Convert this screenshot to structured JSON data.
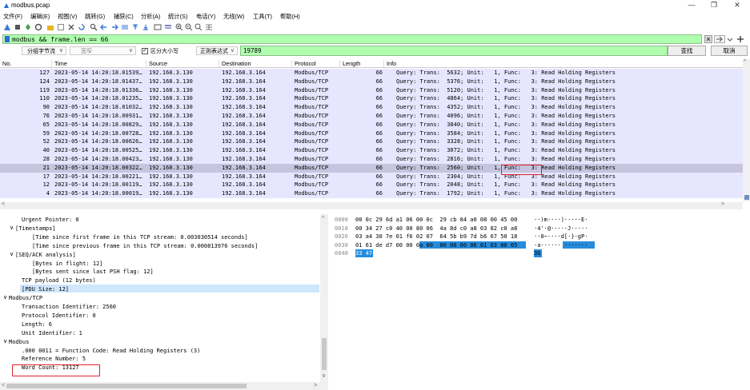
{
  "window": {
    "title": "modbus.pcap",
    "minimize": "—",
    "maximize": "❐",
    "close": "✕"
  },
  "menu": [
    "文件(F)",
    "编辑(E)",
    "视图(V)",
    "跳转(G)",
    "捕获(C)",
    "分析(A)",
    "统计(S)",
    "电话(Y)",
    "无线(W)",
    "工具(T)",
    "帮助(H)"
  ],
  "filter": {
    "value": "modbus && frame.len == 66",
    "colors": {
      "valid_bg": "#afffaf"
    }
  },
  "find": {
    "scope": "分组字节流",
    "charset": "宽窄",
    "case_sensitive_label": "区分大小写",
    "case_sensitive_checked": true,
    "mode": "正则表达式",
    "value": "19789",
    "find_button": "查找",
    "cancel_button": "取消"
  },
  "packet_list": {
    "columns": [
      "No.",
      "Time",
      "Source",
      "Destination",
      "Protocol",
      "Length",
      "Info"
    ],
    "selected_index": 11,
    "rows": [
      {
        "no": "127",
        "time": "2023-05-14 14:20:18.01539…",
        "src": "192.168.3.130",
        "dst": "192.168.3.164",
        "proto": "Modbus/TCP",
        "len": "66",
        "info": "Query: Trans:  5632; Unit:   1, Func:   3: Read Holding Registers"
      },
      {
        "no": "124",
        "time": "2023-05-14 14:20:18.01437…",
        "src": "192.168.3.130",
        "dst": "192.168.3.164",
        "proto": "Modbus/TCP",
        "len": "66",
        "info": "Query: Trans:  5376; Unit:   1, Func:   3: Read Holding Registers"
      },
      {
        "no": "119",
        "time": "2023-05-14 14:20:18.01336…",
        "src": "192.168.3.130",
        "dst": "192.168.3.164",
        "proto": "Modbus/TCP",
        "len": "66",
        "info": "Query: Trans:  5120; Unit:   1, Func:   3: Read Holding Registers"
      },
      {
        "no": "110",
        "time": "2023-05-14 14:20:18.01235…",
        "src": "192.168.3.130",
        "dst": "192.168.3.164",
        "proto": "Modbus/TCP",
        "len": "66",
        "info": "Query: Trans:  4864; Unit:   1, Func:   3: Read Holding Registers"
      },
      {
        "no": "90",
        "time": "2023-05-14 14:20:18.01032…",
        "src": "192.168.3.130",
        "dst": "192.168.3.164",
        "proto": "Modbus/TCP",
        "len": "66",
        "info": "Query: Trans:  4352; Unit:   1, Func:   3: Read Holding Registers"
      },
      {
        "no": "76",
        "time": "2023-05-14 14:20:18.00931…",
        "src": "192.168.3.130",
        "dst": "192.168.3.164",
        "proto": "Modbus/TCP",
        "len": "66",
        "info": "Query: Trans:  4096; Unit:   1, Func:   3: Read Holding Registers"
      },
      {
        "no": "65",
        "time": "2023-05-14 14:20:18.00829…",
        "src": "192.168.3.130",
        "dst": "192.168.3.164",
        "proto": "Modbus/TCP",
        "len": "66",
        "info": "Query: Trans:  3840; Unit:   1, Func:   3: Read Holding Registers"
      },
      {
        "no": "59",
        "time": "2023-05-14 14:20:18.00728…",
        "src": "192.168.3.130",
        "dst": "192.168.3.164",
        "proto": "Modbus/TCP",
        "len": "66",
        "info": "Query: Trans:  3584; Unit:   1, Func:   3: Read Holding Registers"
      },
      {
        "no": "52",
        "time": "2023-05-14 14:20:18.00626…",
        "src": "192.168.3.130",
        "dst": "192.168.3.164",
        "proto": "Modbus/TCP",
        "len": "66",
        "info": "Query: Trans:  3328; Unit:   1, Func:   3: Read Holding Registers"
      },
      {
        "no": "40",
        "time": "2023-05-14 14:20:18.00525…",
        "src": "192.168.3.130",
        "dst": "192.168.3.164",
        "proto": "Modbus/TCP",
        "len": "66",
        "info": "Query: Trans:  3072; Unit:   1, Func:   3: Read Holding Registers"
      },
      {
        "no": "28",
        "time": "2023-05-14 14:20:18.00423…",
        "src": "192.168.3.130",
        "dst": "192.168.3.164",
        "proto": "Modbus/TCP",
        "len": "66",
        "info": "Query: Trans:  2816; Unit:   1, Func:   3: Read Holding Registers"
      },
      {
        "no": "21",
        "time": "2023-05-14 14:20:18.00322…",
        "src": "192.168.3.130",
        "dst": "192.168.3.164",
        "proto": "Modbus/TCP",
        "len": "66",
        "info": "Query: Trans:  2560; Unit:   1, Func:   3: Read Holding Registers"
      },
      {
        "no": "17",
        "time": "2023-05-14 14:20:18.00221…",
        "src": "192.168.3.130",
        "dst": "192.168.3.164",
        "proto": "Modbus/TCP",
        "len": "66",
        "info": "Query: Trans:  2304; Unit:   1, Func:   3: Read Holding Registers"
      },
      {
        "no": "12",
        "time": "2023-05-14 14:20:18.00119…",
        "src": "192.168.3.130",
        "dst": "192.168.3.164",
        "proto": "Modbus/TCP",
        "len": "66",
        "info": "Query: Trans:  2048; Unit:   1, Func:   3: Read Holding Registers"
      },
      {
        "no": "4",
        "time": "2023-05-14 14:20:18.00019…",
        "src": "192.168.3.130",
        "dst": "192.168.3.164",
        "proto": "Modbus/TCP",
        "len": "66",
        "info": "Query: Trans:  1792; Unit:   1, Func:   3: Read Holding Registers"
      }
    ]
  },
  "details": [
    {
      "indent": 2,
      "expander": "",
      "text": "Urgent Pointer: 0"
    },
    {
      "indent": 1,
      "expander": "∨",
      "text": "[Timestamps]"
    },
    {
      "indent": 3,
      "expander": "",
      "text": "[Time since first frame in this TCP stream: 0.003030514 seconds]"
    },
    {
      "indent": 3,
      "expander": "",
      "text": "[Time since previous frame in this TCP stream: 0.000813976 seconds]"
    },
    {
      "indent": 1,
      "expander": "∨",
      "text": "[SEQ/ACK analysis]"
    },
    {
      "indent": 3,
      "expander": "",
      "text": "[Bytes in flight: 12]"
    },
    {
      "indent": 3,
      "expander": "",
      "text": "[Bytes sent since last PSH flag: 12]"
    },
    {
      "indent": 2,
      "expander": "",
      "text": "TCP payload (12 bytes)"
    },
    {
      "indent": 2,
      "expander": "",
      "text": "[PDU Size: 12]"
    },
    {
      "indent": 0,
      "expander": "∨",
      "text": "Modbus/TCP"
    },
    {
      "indent": 2,
      "expander": "",
      "text": "Transaction Identifier: 2560"
    },
    {
      "indent": 2,
      "expander": "",
      "text": "Protocol Identifier: 0"
    },
    {
      "indent": 2,
      "expander": "",
      "text": "Length: 6"
    },
    {
      "indent": 2,
      "expander": "",
      "text": "Unit Identifier: 1"
    },
    {
      "indent": 0,
      "expander": "∨",
      "text": "Modbus"
    },
    {
      "indent": 2,
      "expander": "",
      "text": ".000 0011 = Function Code: Read Holding Registers (3)"
    },
    {
      "indent": 2,
      "expander": "",
      "text": "Reference Number: 5"
    },
    {
      "indent": 2,
      "expander": "",
      "text": "Word Count: 13127"
    }
  ],
  "bytes": {
    "offsets": [
      "0000",
      "0010",
      "0020",
      "0030",
      "0040"
    ],
    "hex_lines": [
      "00 0c 29 6d a1 06 00 0c  29 cb 84 a0 08 00 45 00",
      "00 34 27 c0 40 00 80 06  4a 8d c0 a8 03 82 c0 a8",
      "03 a4 30 7e 01 f6 02 07  64 5b b9 7d b6 67 50 18",
      "01 61 de d7 00 00 0a 00  00 00 00 06 01 03 00 05",
      "33 47"
    ],
    "ascii_lines": [
      "··)m····)·····E·",
      "·4'·@·····J·····",
      "··0~····d[·}·gP·",
      "·a······ ·······",
      "3G"
    ]
  },
  "annotations": {
    "func_box": "Func:  3",
    "word_count_box": "Word Count: 13127"
  }
}
